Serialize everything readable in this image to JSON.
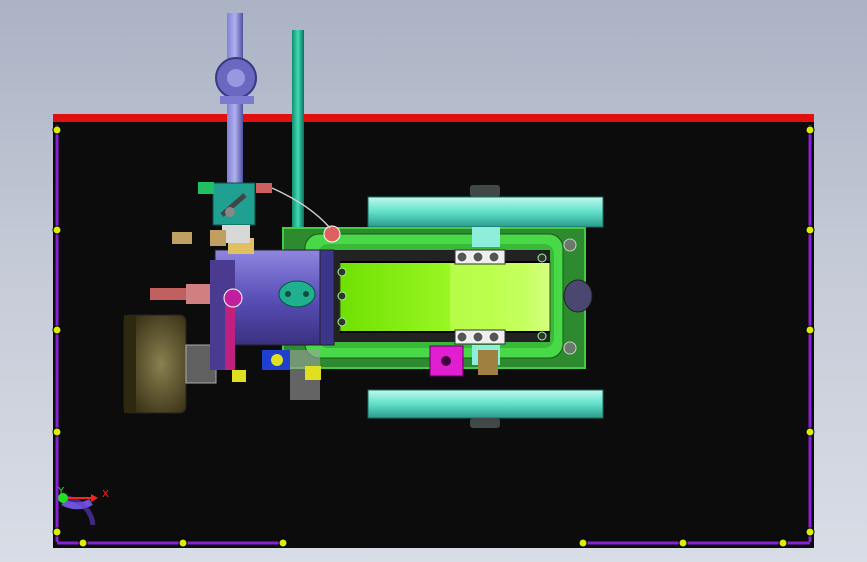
{
  "viewport": {
    "background_top": "#aab2c4",
    "background_bottom": "#d9dde6"
  },
  "frame": {
    "fill": "#0c0c0c",
    "top_edge_color": "#e01010",
    "border_color": "#8a20d8",
    "vertex_color": "#d8f000"
  },
  "triad": {
    "x_label": "X",
    "y_label": "Y",
    "x_color": "#ff2020",
    "y_color": "#20e020",
    "rot_color": "#8060ff"
  },
  "model": {
    "flywheel_color": "#5fe0c8",
    "cylinder_color": "#6a5acd",
    "frame_color": "#48d848",
    "slide_color": "#88ee22",
    "magenta_color": "#e020d0",
    "pipe_color": "#20b090",
    "pipe_blue_color": "#7070c8",
    "pulley_color": "#6a6030"
  }
}
